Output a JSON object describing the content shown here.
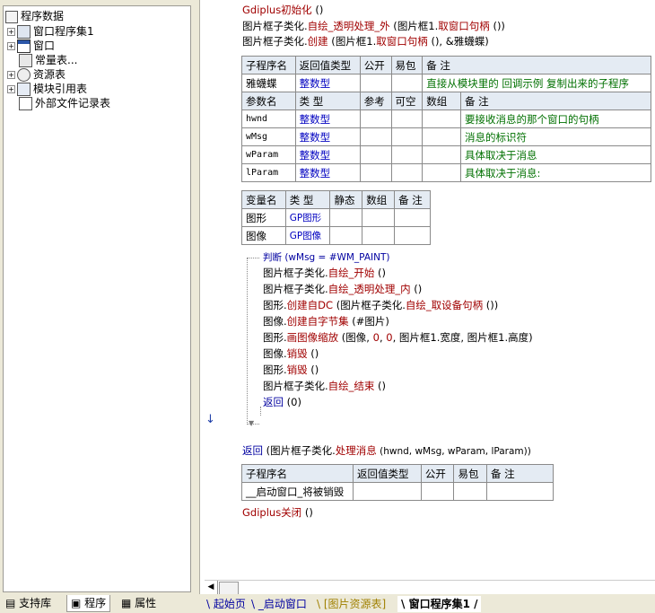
{
  "tree": {
    "root": "程序数据",
    "items": [
      {
        "label": "窗口程序集1",
        "icon": "modules-icon"
      },
      {
        "label": "窗口",
        "icon": "window-icon"
      },
      {
        "label": "常量表...",
        "icon": "constants-icon"
      },
      {
        "label": "资源表",
        "icon": "resources-icon"
      },
      {
        "label": "模块引用表",
        "icon": "module-ref-icon"
      },
      {
        "label": "外部文件记录表",
        "icon": "file-record-icon"
      }
    ]
  },
  "bottom_tabs": [
    "支持库",
    "程序",
    "属性"
  ],
  "code": {
    "l1": {
      "a": "Gdiplus初始化",
      "b": " ()"
    },
    "l2": {
      "a": "图片框子类化",
      "b": ".",
      "c": "自绘_透明处理_外",
      "d": " (",
      "e": "图片框1",
      "f": ".",
      "g": "取窗口句柄",
      "h": " ())"
    },
    "l3": {
      "a": "图片框子类化",
      "b": ".",
      "c": "创建",
      "d": " (",
      "e": "图片框1",
      "f": ".",
      "g": "取窗口句柄",
      "h": " (), &雅蠛蝶)"
    }
  },
  "sub_table": {
    "headers": [
      "子程序名",
      "返回值类型",
      "公开",
      "易包",
      "备 注"
    ],
    "row": [
      "雅蠛蝶",
      "整数型",
      "",
      "",
      "直接从模块里的 回调示例 复制出来的子程序"
    ],
    "param_headers": [
      "参数名",
      "类 型",
      "参考",
      "可空",
      "数组",
      "备 注"
    ],
    "params": [
      [
        "hwnd",
        "整数型",
        "",
        "",
        "",
        "要接收消息的那个窗口的句柄"
      ],
      [
        "wMsg",
        "整数型",
        "",
        "",
        "",
        "消息的标识符"
      ],
      [
        "wParam",
        "整数型",
        "",
        "",
        "",
        "具体取决于消息"
      ],
      [
        "lParam",
        "整数型",
        "",
        "",
        "",
        "具体取决于消息:"
      ]
    ]
  },
  "var_table": {
    "headers": [
      "变量名",
      "类 型",
      "静态",
      "数组",
      "备 注"
    ],
    "rows": [
      [
        "图形",
        "GP图形",
        "",
        "",
        ""
      ],
      [
        "图像",
        "GP图像",
        "",
        "",
        ""
      ]
    ]
  },
  "body": {
    "judge": "判断 (wMsg = #WM_PAINT)",
    "lines": [
      {
        "obj": "图片框子类化",
        "m": "自绘_开始",
        "tail": " ()"
      },
      {
        "obj": "图片框子类化",
        "m": "自绘_透明处理_内",
        "tail": " ()"
      },
      {
        "obj": "图形",
        "m": "创建自DC",
        "tail": " (图片框子类化.",
        "m2": "自绘_取设备句柄",
        "tail2": " ())"
      },
      {
        "obj": "图像",
        "m": "创建自字节集",
        "tail": " (#图片)"
      },
      {
        "obj": "图形",
        "m": "画图像缩放",
        "tail": " (图像, ",
        "n1": "0",
        "sep": ", ",
        "n2": "0",
        "tail2": ", 图片框1.宽度, 图片框1.高度)"
      },
      {
        "obj": "图像",
        "m": "销毁",
        "tail": " ()"
      },
      {
        "obj": "图形",
        "m": "销毁",
        "tail": " ()"
      },
      {
        "obj": "图片框子类化",
        "m": "自绘_结束",
        "tail": " ()"
      }
    ],
    "ret": "返回",
    "ret_arg": " (0)"
  },
  "return_line": {
    "kw": "返回",
    "a": " (图片框子类化.",
    "m": "处理消息",
    "b": " (hwnd, wMsg, wParam, lParam))"
  },
  "sub2_table": {
    "headers": [
      "子程序名",
      "返回值类型",
      "公开",
      "易包",
      "备 注"
    ],
    "row": [
      "__启动窗口_将被销毁",
      "",
      "",
      "",
      ""
    ]
  },
  "close_line": {
    "a": "Gdiplus关闭",
    "b": " ()"
  },
  "editor_tabs": [
    "起始页",
    "_启动窗口",
    "[图片资源表]",
    "窗口程序集1"
  ],
  "colors": {
    "header_bg": "#e4ebf3",
    "keyword": "#a00000",
    "type_blue": "#0000c0",
    "comment_green": "#007000"
  }
}
